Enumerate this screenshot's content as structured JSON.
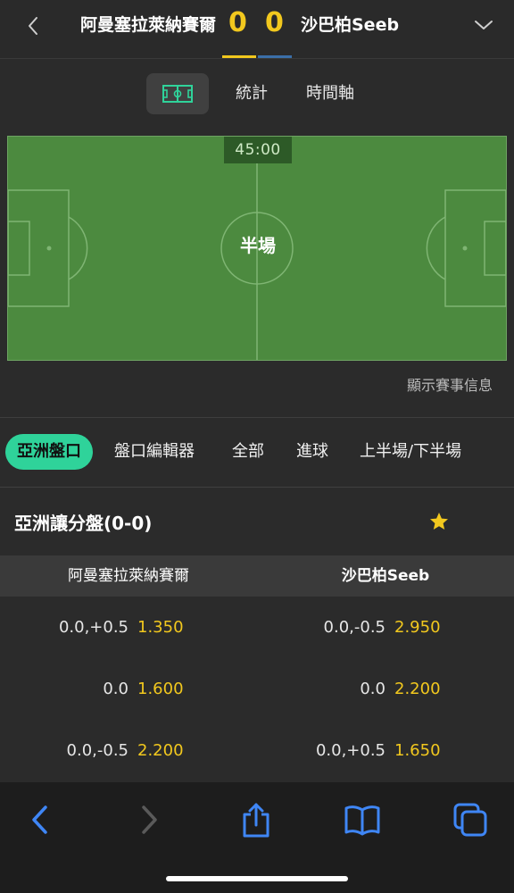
{
  "match": {
    "home_team": "阿曼塞拉萊納賽爾",
    "away_team": "沙巴柏Seeb",
    "home_score": "0",
    "away_score": "0"
  },
  "view_tabs": {
    "pitch_icon": "pitch-icon",
    "stats": "統計",
    "timeline": "時間軸"
  },
  "pitch": {
    "clock": "45:00",
    "status": "半場"
  },
  "show_info": "顯示賽事信息",
  "market_tabs": [
    "亞洲盤口",
    "盤口編輯器",
    "全部",
    "進球",
    "上半場/下半場"
  ],
  "asian_handicap": {
    "title": "亞洲讓分盤(0-0)",
    "columns": {
      "home": "阿曼塞拉萊納賽爾",
      "away": "沙巴柏Seeb"
    },
    "rows": [
      {
        "home_line": "0.0,+0.5",
        "home_price": "1.350",
        "away_line": "0.0,-0.5",
        "away_price": "2.950"
      },
      {
        "home_line": "0.0",
        "home_price": "1.600",
        "away_line": "0.0",
        "away_price": "2.200"
      },
      {
        "home_line": "0.0,-0.5",
        "home_price": "2.200",
        "away_line": "0.0,+0.5",
        "away_price": "1.650"
      }
    ]
  },
  "colors": {
    "accent_yellow": "#f2c81e",
    "active_tab_green": "#2fd39a",
    "pitch_green": "#4c8a3f",
    "browser_blue": "#3f86f5"
  },
  "toolbar_icons": [
    "back-icon",
    "forward-icon",
    "share-icon",
    "bookmarks-icon",
    "tabs-icon"
  ]
}
